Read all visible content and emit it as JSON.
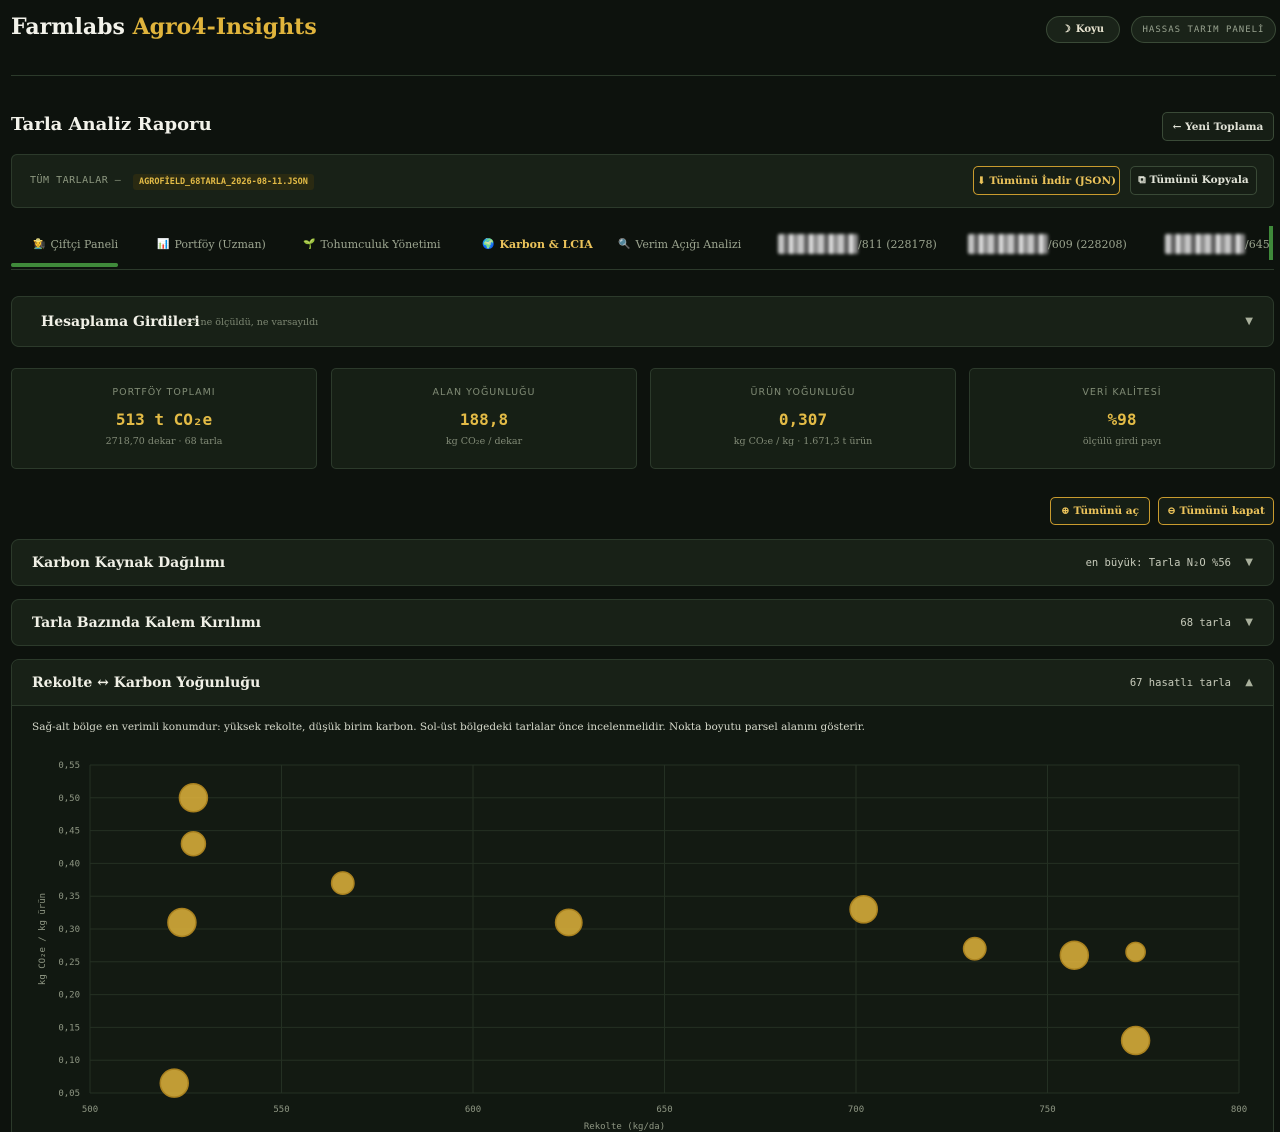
{
  "header": {
    "brand_main": "Farmlabs",
    "brand_accent": "Agro4-Insights",
    "theme_icon": "moon-icon",
    "theme_label": "Koyu",
    "panel_label": "HASSAS TARIM PANELİ"
  },
  "report": {
    "title": "Tarla Analiz Raporu",
    "new_button": "← Yeni Toplama"
  },
  "filebar": {
    "label": "TÜM TARLALAR —",
    "filename": "AGROFİELD_68TARLA_2026-08-11.JSON",
    "download_label": "⬇ Tümünü İndir (JSON)",
    "copy_label": "⧉ Tümünü Kopyala"
  },
  "tabs": [
    {
      "icon": "👩‍🌾",
      "label": "Çiftçi Paneli"
    },
    {
      "icon": "📊",
      "label": "Portföy (Uzman)"
    },
    {
      "icon": "🌱",
      "label": "Tohumculuk Yönetimi"
    },
    {
      "icon": "🌍",
      "label": "Karbon & LCIA"
    },
    {
      "icon": "🔍",
      "label": "Verim Açığı Analizi"
    },
    {
      "icon": "",
      "label": "/811 (228178)"
    },
    {
      "icon": "",
      "label": "/609 (228208)"
    },
    {
      "icon": "",
      "label": "/645"
    }
  ],
  "inputs_panel": {
    "title": "Hesaplama Girdileri",
    "subtitle": "— ne ölçüldü, ne varsayıldı",
    "chevron": "▼"
  },
  "kpis": [
    {
      "label": "PORTFÖY TOPLAMI",
      "value": "513 t CO₂e",
      "sub": "2718,70 dekar · 68 tarla"
    },
    {
      "label": "ALAN YOĞUNLUĞU",
      "value": "188,8",
      "sub": "kg CO₂e / dekar"
    },
    {
      "label": "ÜRÜN YOĞUNLUĞU",
      "value": "0,307",
      "sub": "kg CO₂e / kg · 1.671,3 t ürün"
    },
    {
      "label": "VERİ KALİTESİ",
      "value": "%98",
      "sub": "ölçülü girdi payı"
    }
  ],
  "actions": {
    "expand_all": "⊕ Tümünü aç",
    "collapse_all": "⊖ Tümünü kapat"
  },
  "sections": [
    {
      "title": "Karbon Kaynak Dağılımı",
      "meta": "en büyük: Tarla N₂O %56",
      "chevron": "▼"
    },
    {
      "title": "Tarla Bazında Kalem Kırılımı",
      "meta": "68 tarla",
      "chevron": "▼"
    },
    {
      "title": "Rekolte ↔ Karbon Yoğunluğu",
      "meta": "67 hasatlı tarla",
      "chevron": "▲",
      "description": "Sağ-alt bölge en verimli konumdur: yüksek rekolte, düşük birim karbon. Sol-üst bölgedeki tarlalar önce incelenmelidir. Nokta boyutu parsel alanını gösterir."
    }
  ],
  "colors": {
    "accent": "#e0b43c",
    "background": "#0d120d",
    "panel": "#182117",
    "active_tab": "#3f8a3a"
  },
  "chart_data": {
    "type": "scatter",
    "title": "",
    "xlabel": "Rekolte (kg/da)",
    "ylabel": "kg CO₂e / kg ürün",
    "xlim": [
      500,
      800
    ],
    "ylim": [
      0.05,
      0.55
    ],
    "x_ticks": [
      "500",
      "550",
      "600",
      "650",
      "700",
      "750",
      "800"
    ],
    "y_ticks": [
      "0,05",
      "0,10",
      "0,15",
      "0,20",
      "0,25",
      "0,30",
      "0,35",
      "0,40",
      "0,45",
      "0,50",
      "0,55"
    ],
    "grid": true,
    "size_encodes": "parsel alanı",
    "points": [
      {
        "x": 527,
        "y": 0.5,
        "size": 1.0
      },
      {
        "x": 527,
        "y": 0.43,
        "size": 0.75
      },
      {
        "x": 524,
        "y": 0.31,
        "size": 1.0
      },
      {
        "x": 522,
        "y": 0.065,
        "size": 1.0
      },
      {
        "x": 566,
        "y": 0.37,
        "size": 0.65
      },
      {
        "x": 625,
        "y": 0.31,
        "size": 0.9
      },
      {
        "x": 702,
        "y": 0.33,
        "size": 0.95
      },
      {
        "x": 731,
        "y": 0.27,
        "size": 0.65
      },
      {
        "x": 757,
        "y": 0.26,
        "size": 1.0
      },
      {
        "x": 773,
        "y": 0.265,
        "size": 0.45
      },
      {
        "x": 773,
        "y": 0.13,
        "size": 1.0
      }
    ]
  }
}
